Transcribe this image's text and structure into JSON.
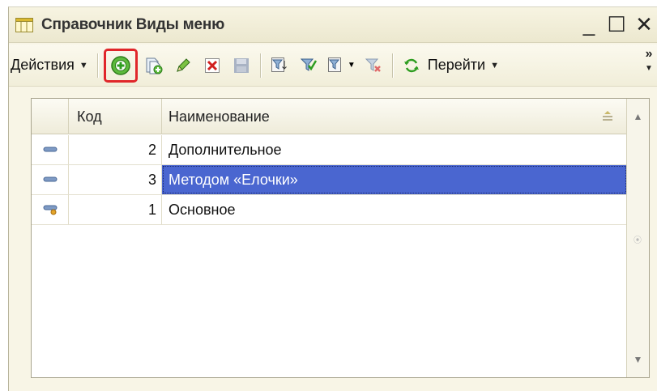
{
  "window": {
    "title": "Справочник Виды меню",
    "minimize_glyph": "_",
    "maximize_glyph": "☐",
    "close_glyph": "✕"
  },
  "toolbar": {
    "actions_label": "Действия",
    "goto_label": "Перейти",
    "overflow_glyph": "»",
    "highlight_color": "#e0262a",
    "buttons": [
      {
        "name": "add-icon",
        "highlighted": true
      },
      {
        "name": "copy-icon"
      },
      {
        "name": "edit-pencil-icon"
      },
      {
        "name": "delete-icon"
      },
      {
        "name": "save-disabled-icon"
      },
      {
        "name": "filter-set-icon"
      },
      {
        "name": "filter-by-value-icon"
      },
      {
        "name": "filter-history-icon"
      },
      {
        "name": "filter-clear-icon"
      },
      {
        "name": "refresh-icon"
      }
    ]
  },
  "table": {
    "columns": [
      "Код",
      "Наименование"
    ],
    "rows": [
      {
        "code": "2",
        "name": "Дополнительное",
        "icon": "item-icon",
        "selected": false
      },
      {
        "code": "3",
        "name": "Методом «Елочки»",
        "icon": "item-icon",
        "selected": true
      },
      {
        "code": "1",
        "name": "Основное",
        "icon": "item-default-icon",
        "selected": false
      }
    ],
    "selection_color": "#4a66d0"
  }
}
